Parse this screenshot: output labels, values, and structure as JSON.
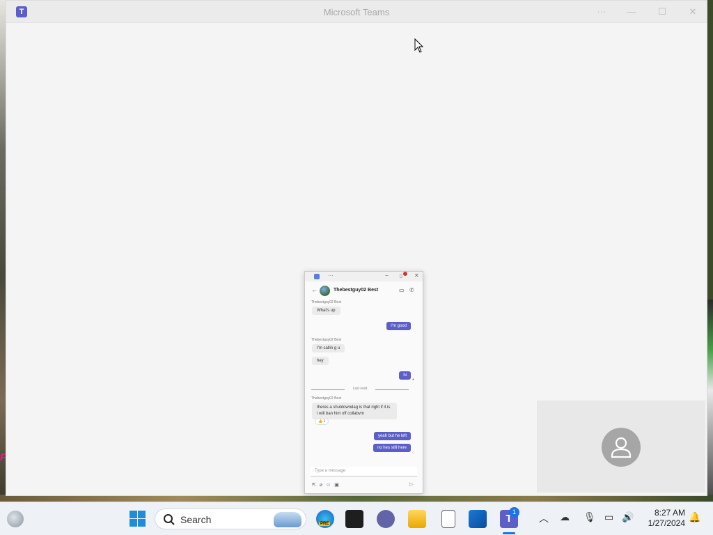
{
  "window": {
    "title": "Microsoft Teams",
    "app_icon": "teams-icon",
    "controls": [
      "more-icon",
      "minimize-icon",
      "maximize-icon",
      "close-icon"
    ]
  },
  "chat_popout": {
    "titlebar": {
      "more": "···",
      "minimize": "−",
      "close": "✕"
    },
    "contact_name": "Thebestguy02 Best",
    "messages": [
      {
        "direction": "in",
        "sender": "Thebestguy02 Best",
        "text": "What's up"
      },
      {
        "direction": "out",
        "text": "I'm good"
      },
      {
        "direction": "in",
        "sender": "Thebestguy02 Best",
        "text": "I'm callin g u"
      },
      {
        "direction": "in",
        "text": "hey"
      },
      {
        "direction": "out",
        "text": "hi"
      },
      {
        "direction": "in",
        "sender": "Thebestguy02 Best",
        "text": "theres a shutdowndag is that right if it is i will ban him off collabvm",
        "reaction": "👍 1"
      },
      {
        "direction": "out",
        "text": "yeah but he left"
      },
      {
        "direction": "out",
        "text": "no hes still here"
      }
    ],
    "last_read_label": "Last read",
    "compose_placeholder": "Type a message"
  },
  "taskbar": {
    "search_label": "Search",
    "edge_badge": "PRE",
    "teams_badge_count": "1",
    "clock_time": "8:27 AM",
    "clock_date": "1/27/2024"
  },
  "colors": {
    "teams_purple": "#5b5fc7",
    "taskbar_bg": "#eef1f5",
    "window_bg": "#f4f4f4"
  }
}
